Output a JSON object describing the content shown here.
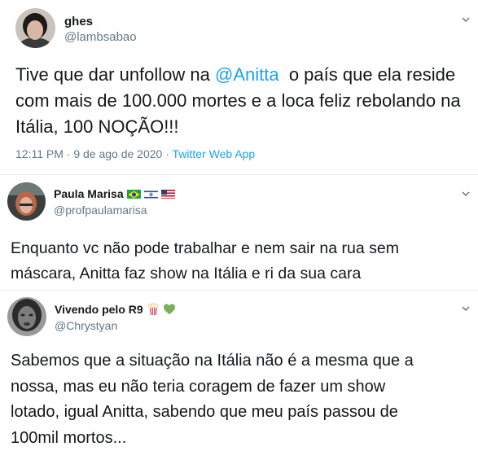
{
  "tweets": [
    {
      "name": "ghes",
      "handle": "@lambsabao",
      "text_before": "Tive que dar unfollow na ",
      "mention": "@Anitta",
      "text_after": "  o país que ela reside\ncom mais de 100.000 mortes e a loca feliz rebolando na\nItália, 100 NOÇÃO!!!",
      "time": "12:11 PM · 9 de ago de 2020 · ",
      "source": "Twitter Web App"
    },
    {
      "name": "Paula Marisa",
      "handle": "@profpaulamarisa",
      "flags": [
        "brazil-flag",
        "israel-flag",
        "usa-flag"
      ],
      "text": "Enquanto vc não pode trabalhar e nem sair na rua sem\nmáscara, Anitta faz show na Itália e ri da sua cara"
    },
    {
      "name": "Vivendo pelo R9",
      "handle": "@Chrystyan",
      "emojis": [
        "popcorn-icon",
        "green-heart-icon"
      ],
      "text": "Sabemos que a situação na Itália não é a mesma que a\nnossa, mas eu não teria coragem de fazer um show\nlotado, igual Anitta, sabendo que meu país passou de\n100mil mortos..."
    }
  ],
  "colors": {
    "link": "#1da1f2",
    "secondary": "#657786",
    "divider": "#e6ecf0",
    "text": "#14171a"
  },
  "icons": [
    "chevron-down-icon"
  ]
}
